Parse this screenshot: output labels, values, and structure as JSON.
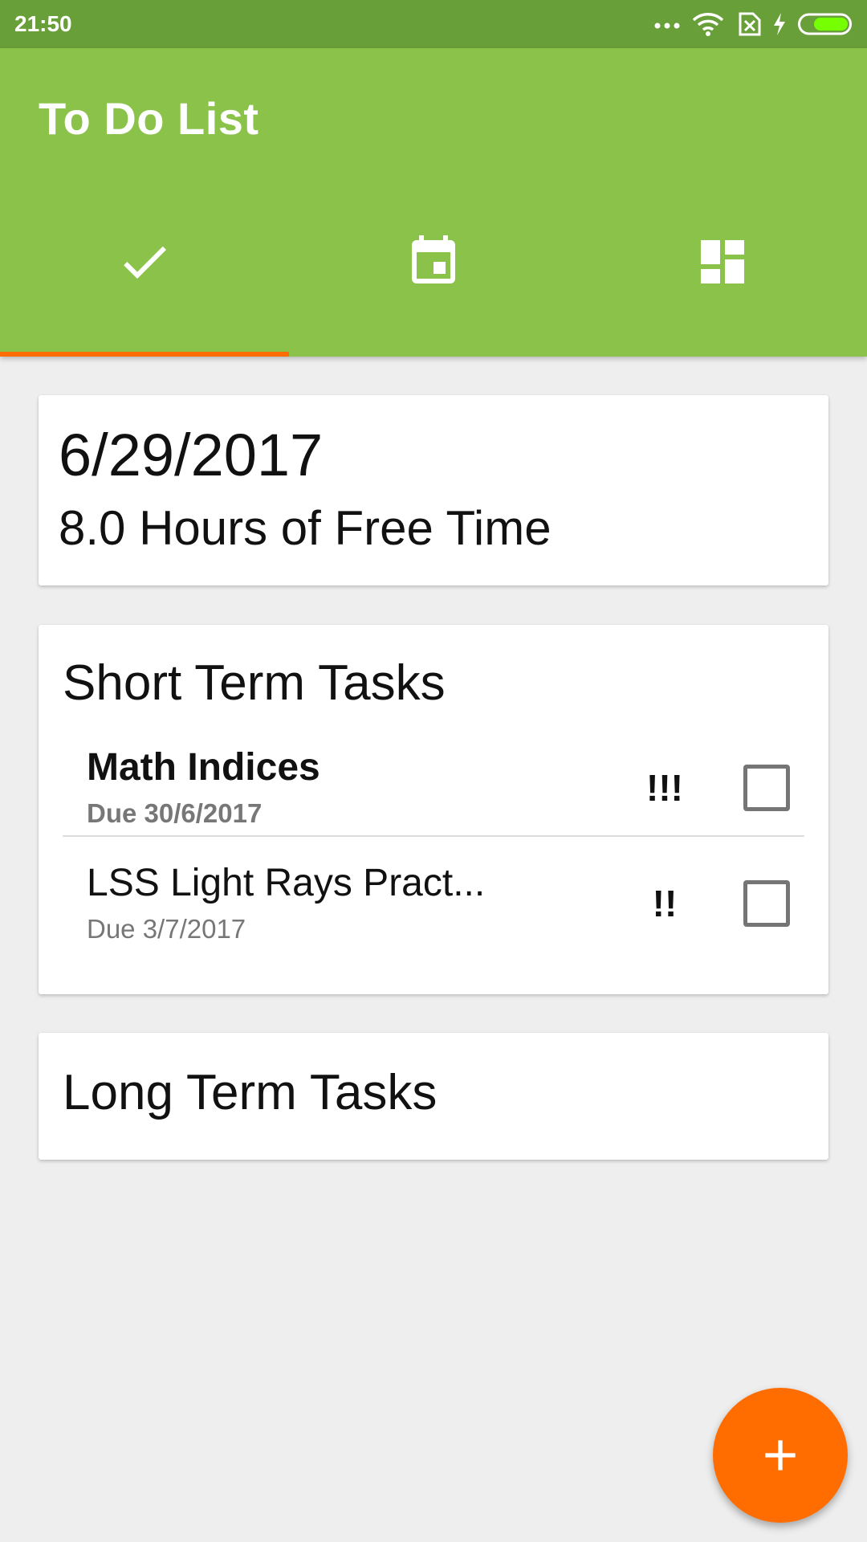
{
  "status_bar": {
    "time": "21:50",
    "icons": [
      "more-dots-icon",
      "wifi-icon",
      "sim-off-icon",
      "charging-bolt-icon",
      "battery-icon"
    ]
  },
  "app_bar": {
    "title": "To Do List",
    "background_color": "#8bc34a",
    "status_color": "#689f38"
  },
  "tabs": [
    {
      "icon": "check-icon",
      "active": true
    },
    {
      "icon": "calendar-event-icon",
      "active": false
    },
    {
      "icon": "dashboard-icon",
      "active": false
    }
  ],
  "accent_color": "#ff6d00",
  "summary": {
    "date": "6/29/2017",
    "free_time": "8.0 Hours of Free Time"
  },
  "short_term": {
    "title": "Short Term Tasks",
    "tasks": [
      {
        "title": "Math Indices",
        "due": "Due 30/6/2017",
        "priority": "!!!",
        "checked": false
      },
      {
        "title": "LSS Light Rays Pract...",
        "due": "Due 3/7/2017",
        "priority": "!!",
        "checked": false
      }
    ]
  },
  "long_term": {
    "title": "Long Term Tasks"
  },
  "fab": {
    "icon": "add-icon"
  }
}
